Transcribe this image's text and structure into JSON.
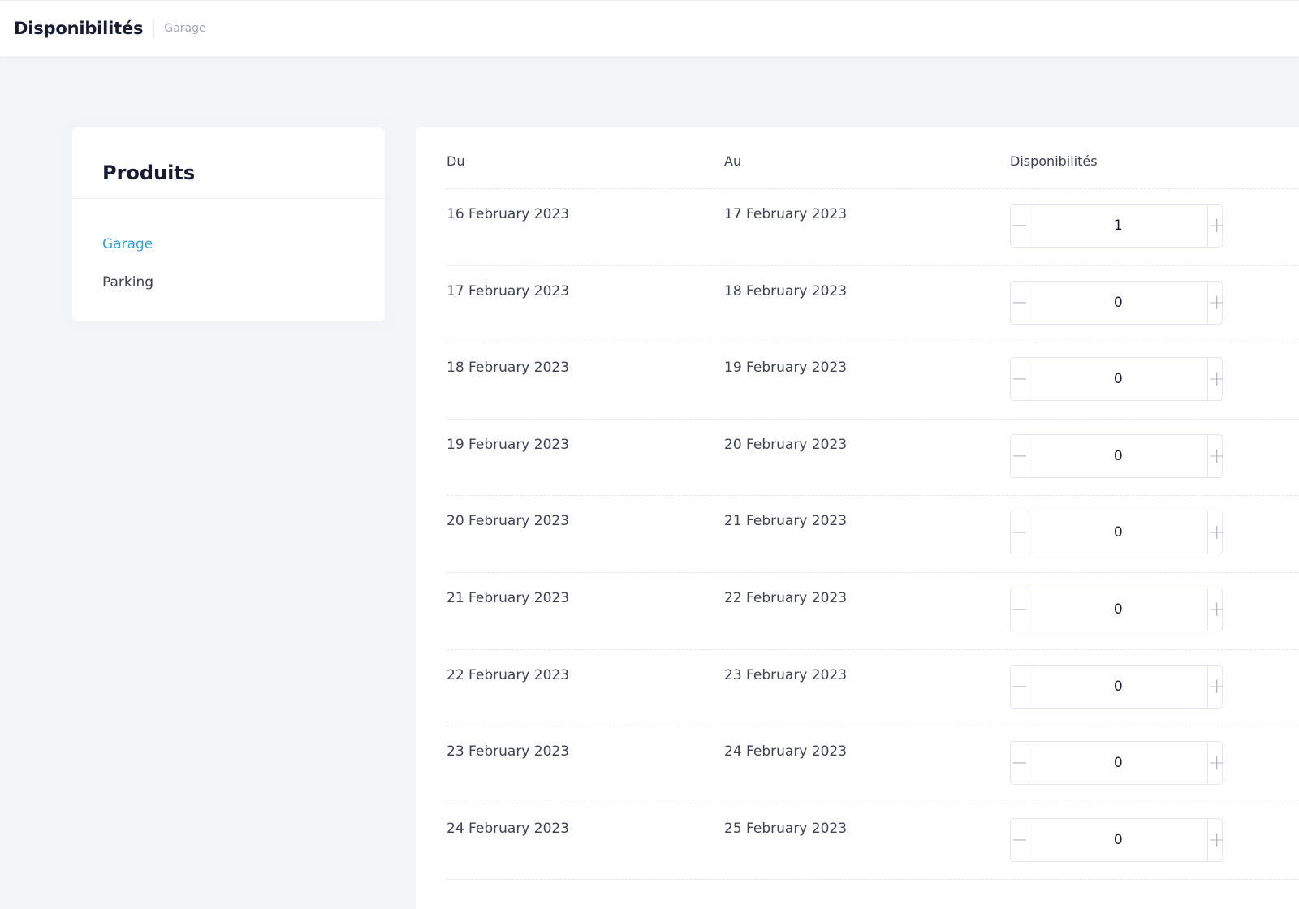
{
  "header": {
    "title": "Disponibilités",
    "breadcrumb": "Garage"
  },
  "sidebar": {
    "title": "Produits",
    "items": [
      {
        "label": "Garage",
        "active": true
      },
      {
        "label": "Parking",
        "active": false
      }
    ]
  },
  "table": {
    "columns": [
      "Du",
      "Au",
      "Disponibilités"
    ],
    "rows": [
      {
        "from": "16 February 2023",
        "to": "17 February 2023",
        "availability": "1"
      },
      {
        "from": "17 February 2023",
        "to": "18 February 2023",
        "availability": "0"
      },
      {
        "from": "18 February 2023",
        "to": "19 February 2023",
        "availability": "0"
      },
      {
        "from": "19 February 2023",
        "to": "20 February 2023",
        "availability": "0"
      },
      {
        "from": "20 February 2023",
        "to": "21 February 2023",
        "availability": "0"
      },
      {
        "from": "21 February 2023",
        "to": "22 February 2023",
        "availability": "0"
      },
      {
        "from": "22 February 2023",
        "to": "23 February 2023",
        "availability": "0"
      },
      {
        "from": "23 February 2023",
        "to": "24 February 2023",
        "availability": "0"
      },
      {
        "from": "24 February 2023",
        "to": "25 February 2023",
        "availability": "0"
      }
    ],
    "stepper": {
      "minus_symbol": "−",
      "plus_symbol": "+"
    }
  },
  "colors": {
    "accent": "#2ea5e0",
    "background": "#f3f6f9",
    "text": "#3f4254",
    "heading": "#181c32"
  }
}
